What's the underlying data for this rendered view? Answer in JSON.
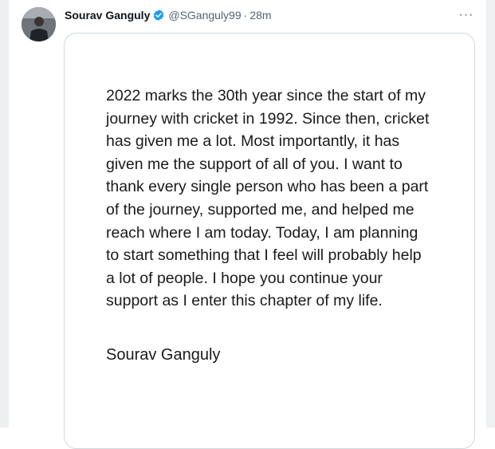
{
  "tweet": {
    "author_name": "Sourav Ganguly",
    "handle": "@SGanguly99",
    "separator": "·",
    "time": "28m",
    "more_glyph": "···",
    "verified_color": "#1d9bf0"
  },
  "image": {
    "lines": "2022 marks the 30th year since the start of my\njourney with cricket in 1992. Since then, cricket\nhas given me a lot. Most importantly, it has\ngiven me the support of all of you. I want to\nthank every single person who has been a part\nof the journey, supported me, and helped me\nreach where I am today. Today, I am planning\nto start something that I feel will probably help\na lot of people.  I hope you continue your\nsupport as I enter this chapter of my life.",
    "signature": "Sourav Ganguly"
  }
}
